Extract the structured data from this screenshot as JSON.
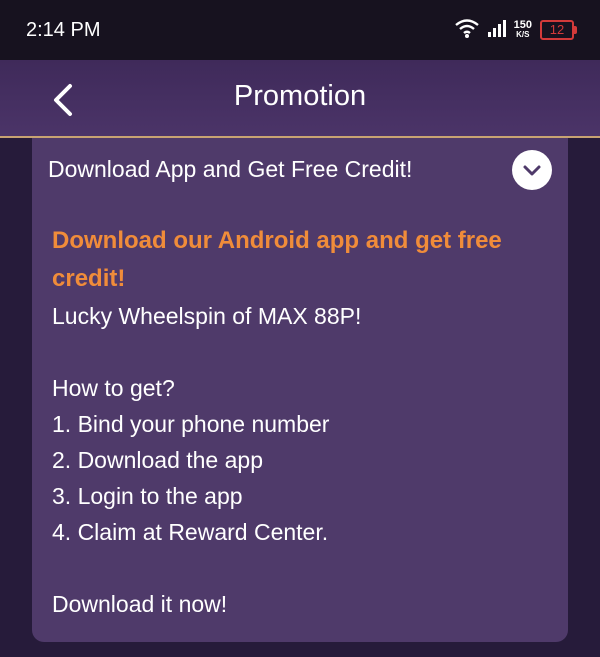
{
  "status_bar": {
    "time": "2:14 PM",
    "speed_value": "150",
    "speed_unit": "K/S",
    "battery": "12"
  },
  "header": {
    "title": "Promotion"
  },
  "promo": {
    "title": "Download App and Get Free Credit!",
    "headline": "Download our Android app and get free credit!",
    "subline": "Lucky Wheelspin of MAX 88P!",
    "how_to": "How to get?",
    "steps": [
      "1. Bind your phone number",
      "2. Download the app",
      "3. Login to the app",
      "4. Claim at Reward Center."
    ],
    "cta": "Download it now!"
  },
  "colors": {
    "accent_orange": "#f08c3a",
    "card_bg": "#4f3a6a",
    "header_border": "#c8a372",
    "battery_low": "#d33a3a"
  },
  "icons": [
    "wifi-icon",
    "signal-icon",
    "battery-icon",
    "back-arrow-icon",
    "chevron-down-icon"
  ]
}
